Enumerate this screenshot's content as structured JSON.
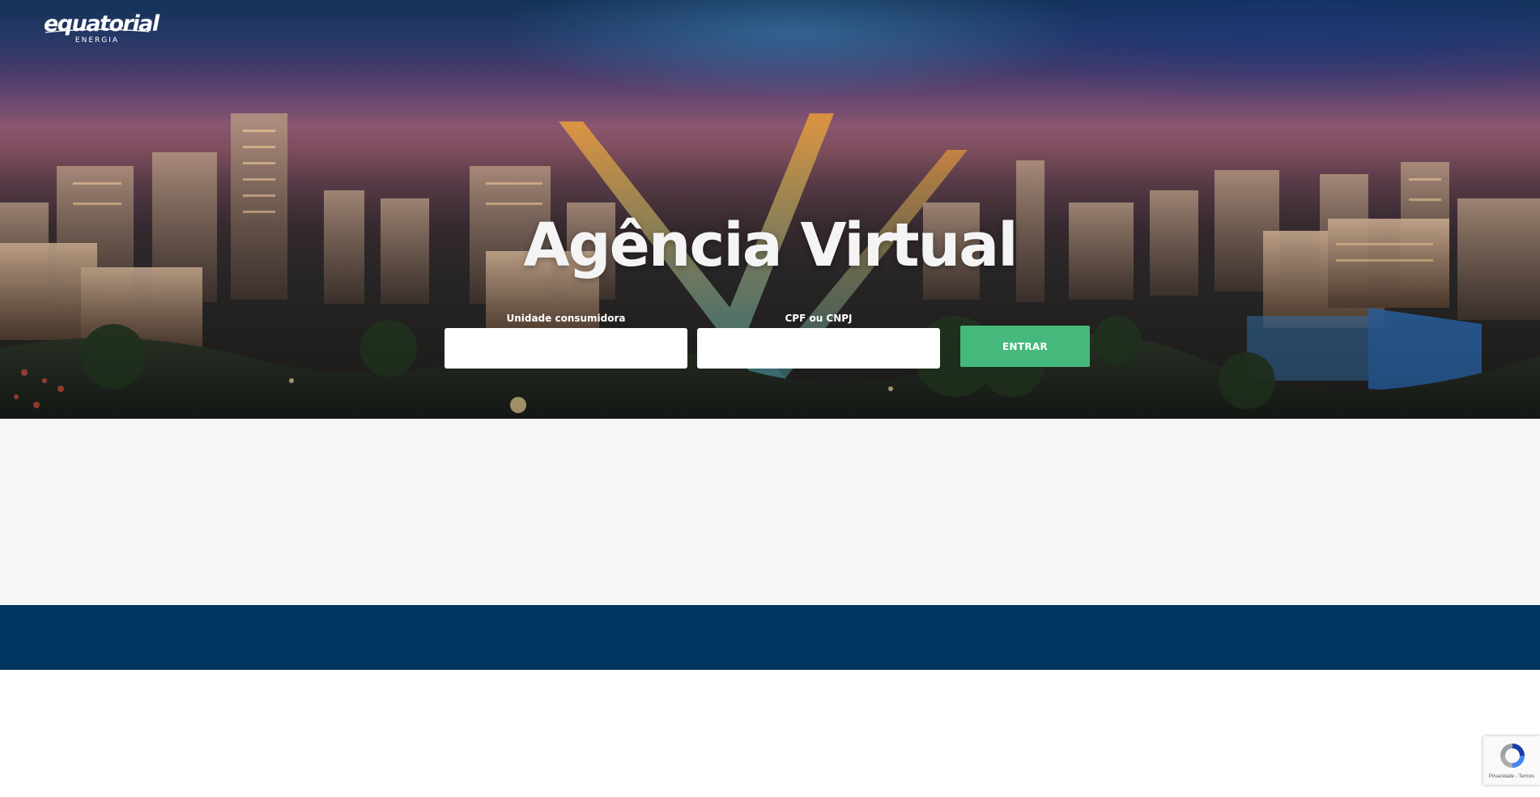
{
  "brand": {
    "logo_word": "equatorial",
    "logo_sub": "ENERGIA"
  },
  "hero": {
    "title": "Agência Virtual"
  },
  "login_form": {
    "unit_label": "Unidade consumidora",
    "unit_value": "",
    "doc_label": "CPF ou CNPJ",
    "doc_value": "",
    "submit_label": "ENTRAR"
  },
  "recaptcha": {
    "links": "Privacidade - Termos"
  },
  "colors": {
    "button_green": "#45b97b",
    "navy_footer": "#003660",
    "light_section": "#f6f6f6"
  }
}
